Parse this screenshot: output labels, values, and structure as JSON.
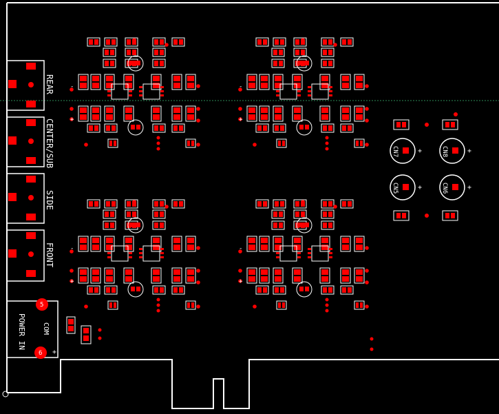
{
  "colors": {
    "background": "#000000",
    "outline": "#ffffff",
    "pad": "#ff0000",
    "guide": "#2e8b57"
  },
  "connectors": [
    {
      "id": "rear",
      "label": "REAR"
    },
    {
      "id": "center-sub",
      "label": "CENTER/SUB"
    },
    {
      "id": "side",
      "label": "SIDE"
    },
    {
      "id": "front",
      "label": "FRONT"
    }
  ],
  "power": {
    "label": "POWER IN",
    "sublabel": "COM",
    "pin_top": "5",
    "pin_bottom": "6",
    "plus": "+"
  },
  "caps": [
    "CN7",
    "CN8",
    "CN5",
    "CN6"
  ],
  "marks": {
    "plus": "+",
    "minus": "-"
  }
}
